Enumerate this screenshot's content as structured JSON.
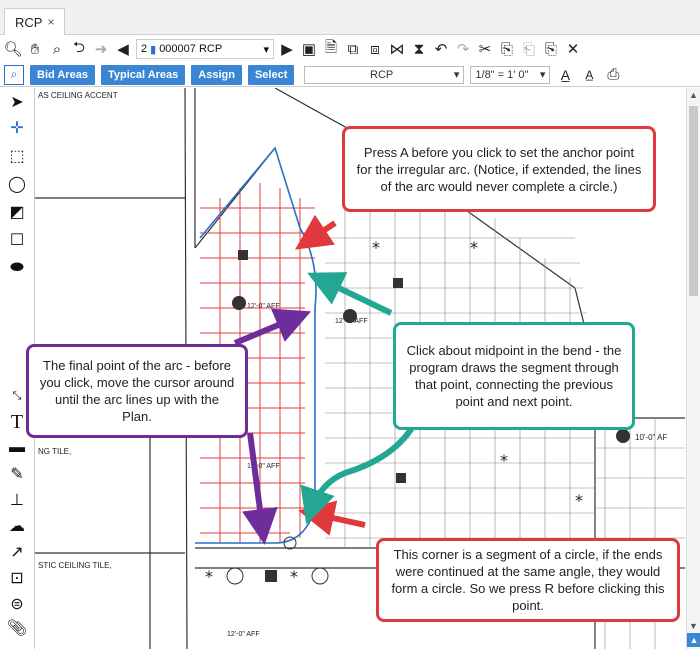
{
  "tab": {
    "label": "RCP",
    "close": "×"
  },
  "toolbar1": {
    "page_number": "2",
    "page_name": "000007 RCP"
  },
  "toolbar2": {
    "buttons": [
      "Bid Areas",
      "Typical Areas",
      "Assign",
      "Select"
    ],
    "layer_combo": "RCP",
    "scale_combo": "1/8\" = 1' 0\""
  },
  "plan_labels": {
    "top1": "AS CEILING ACCENT",
    "left1": "NG TILE,",
    "left2": "STIC CEILING TILE,",
    "right1": "10'-0\" AF",
    "aff1": "12'-0\" AFF",
    "aff2": "12'-0\" AFF",
    "aff3": "12'-0\" AFF",
    "aff4": "12'-0\" AFF"
  },
  "callouts": {
    "anchor": "Press A before you click to set the anchor point for the irregular arc. (Notice, if extended, the lines of the arc would never complete a circle.)",
    "midpoint": "Click about midpoint in the bend - the program draws the segment through that point, connecting the previous point and next point.",
    "final": "The final point of the arc - before you click, move the cursor around until the arc lines up with the Plan.",
    "corner": "This corner is a segment of a circle, if the ends were continued at the same angle, they would form a circle. So we press R before clicking this point."
  },
  "colors": {
    "red": "#e0393d",
    "teal": "#23a792",
    "purple": "#6d2e9b",
    "accent_blue": "#3a86d4"
  }
}
